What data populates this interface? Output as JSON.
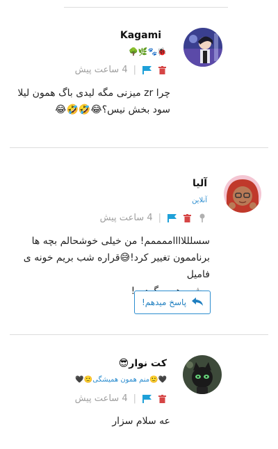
{
  "colors": {
    "accent": "#1ea0d8",
    "trash": "#d64545",
    "pin": "#b0b0b0",
    "online": "#2a8ccf",
    "divider": "#dcdcdc",
    "meta": "#9e9e9e"
  },
  "comments": [
    {
      "author": "Kagami",
      "badges": "🐞🐾🌿🌳",
      "time": "4 ساعت پیش",
      "lines": [
        "چرا zr میزنی مگه لیدی باگ همون لیلا",
        "سود بخش نیس؟😂🤣🤣😂"
      ],
      "avatar_icon": "kagami-avatar"
    },
    {
      "author": "آلیا",
      "status": "آنلاین",
      "time": "4 ساعت پیش",
      "lines": [
        "سسلللااااممممم! من خیلی خوشحالم بچه ها",
        "برناممون تغییر کرد!😅قراره شب بریم خونه ی فامیل",
        "و شب هم برگردیم!"
      ],
      "reply_label": "پاسخ میدهم!",
      "avatar_icon": "alya-avatar"
    },
    {
      "author": "کت نوار😎",
      "badges": "🖤🙂منم همون همیشگی🙂🖤",
      "time": "4 ساعت پیش",
      "lines": [
        "عه سلام سزار"
      ],
      "avatar_icon": "catnoir-avatar"
    }
  ]
}
